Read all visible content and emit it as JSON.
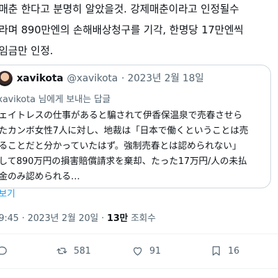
{
  "tweet_text": {
    "line1": "매춘 한다고 분명히 알았을것. 강제매춘이라고 인정될수",
    "line2": "라며 890만엔의 손해배상청구를 기각, 한명당 17만엔씩",
    "line3": "임금만 인정."
  },
  "quoted_tweet": {
    "display_name": "xavikota",
    "handle": "@xavikota",
    "date": "· 2023년 2월 18일",
    "reply_to": "xavikota 님에게 보내는 답글",
    "lines": [
      "ェイトレスの仕事があると騙されて伊香保温泉で売春させら",
      "たカンボ女性7人に対し、地裁は「日本で働くということは売",
      "ることだと分かっていたはず。強制売春とは認められない」",
      "して890万円の損害賠償請求を棄却、たった17万円/人の未払",
      "金のみ認められる…"
    ],
    "show_more": "보기"
  },
  "meta": {
    "time_date": "9:45 · 2023년 2월 20일 · ",
    "views_count": "13만",
    "views_label": " 조회수"
  },
  "actions": {
    "reply_count": "",
    "retweet_count": "581",
    "like_count": "91",
    "bookmark_count": "16"
  },
  "colors": {
    "text": "#0f1419",
    "secondary": "#536471",
    "link": "#1d9bf0",
    "border": "#cfd9de"
  }
}
